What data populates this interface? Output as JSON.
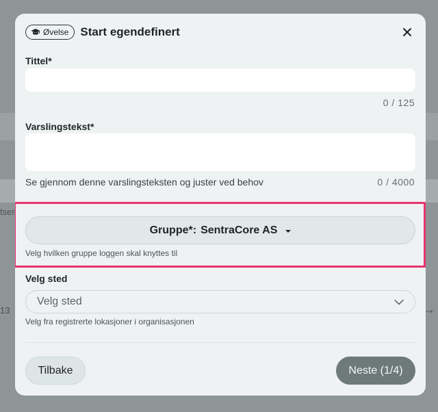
{
  "background": {
    "fragment_left_top": "tser",
    "fragment_left_bottom": "13",
    "fragment_right_top": " ",
    "fragment_right_bottom": "→"
  },
  "modal": {
    "badge": "Øvelse",
    "title": "Start egendefinert",
    "close_icon": "close-icon"
  },
  "fields": {
    "title_label": "Tittel*",
    "title_value": "",
    "title_counter": "0 / 125",
    "message_label": "Varslingstekst*",
    "message_value": "",
    "message_hint": "Se gjennom denne varslingsteksten og juster ved behov",
    "message_counter": "0 / 4000"
  },
  "group": {
    "label": "Gruppe*:",
    "value": "SentraCore AS",
    "hint": "Velg hvilken gruppe loggen skal knyttes til",
    "highlight_color": "#e8336d"
  },
  "location": {
    "label": "Velg sted",
    "placeholder": "Velg sted",
    "hint": "Velg fra registrerte lokasjoner i organisasjonen"
  },
  "footer": {
    "back_label": "Tilbake",
    "next_label": "Neste (1/4)"
  }
}
